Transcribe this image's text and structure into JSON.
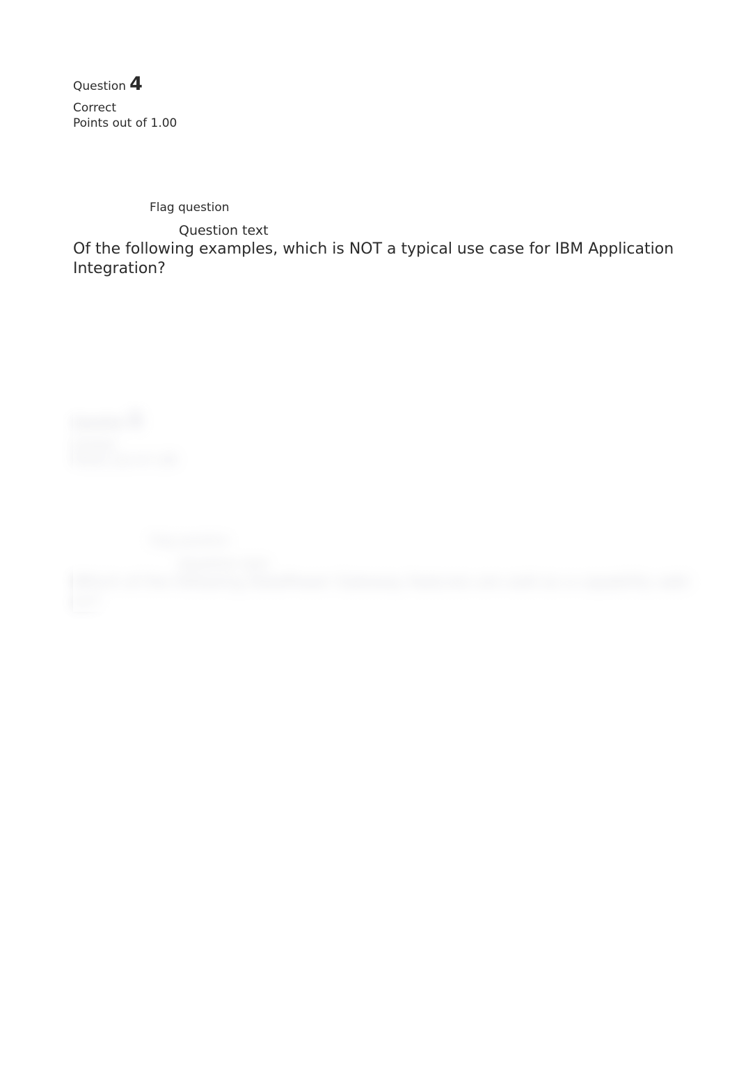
{
  "question4": {
    "label": "Question",
    "number": "4",
    "status": "Correct",
    "points": "Points out of 1.00",
    "flag": "Flag question",
    "text_heading": "Question text",
    "text_body": "Of the following examples, which is NOT a typical use case for IBM Application Integration?"
  },
  "question5_blurred": {
    "label": "Question",
    "number": "5",
    "status": "Correct",
    "points": "Points out of 1.00",
    "flag": "Flag question",
    "text_heading": "Question text",
    "text_body": "Which of the following DataPower Gateway features are sold as a capability add-on?"
  }
}
